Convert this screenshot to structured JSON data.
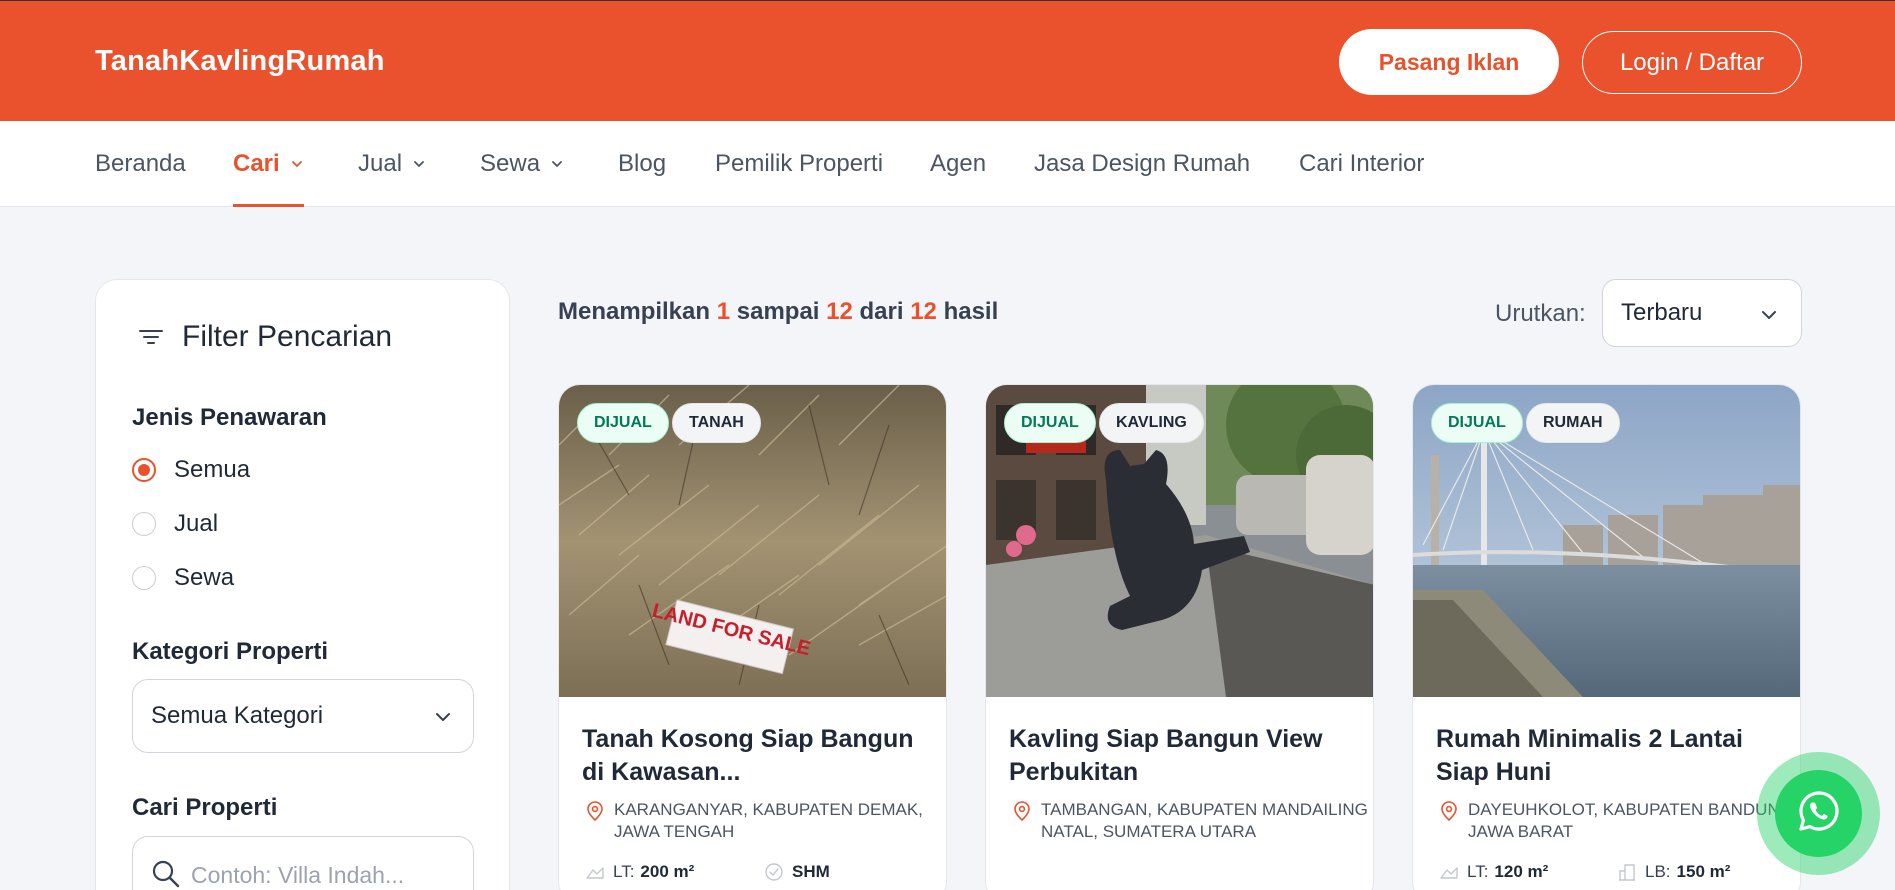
{
  "header": {
    "brand": "TanahKavlingRumah",
    "post_ad_label": "Pasang Iklan",
    "login_label": "Login / Daftar",
    "brand_color": "#e9522c"
  },
  "nav": {
    "items": [
      {
        "label": "Beranda"
      },
      {
        "label": "Cari",
        "active": true,
        "dropdown": true
      },
      {
        "label": "Jual",
        "dropdown": true
      },
      {
        "label": "Sewa",
        "dropdown": true
      },
      {
        "label": "Blog"
      },
      {
        "label": "Pemilik Properti"
      },
      {
        "label": "Agen"
      },
      {
        "label": "Jasa Design Rumah"
      },
      {
        "label": "Cari Interior"
      }
    ]
  },
  "filter": {
    "title": "Filter Pencarian",
    "offer_type_label": "Jenis Penawaran",
    "offer_options": [
      {
        "label": "Semua",
        "checked": true
      },
      {
        "label": "Jual",
        "checked": false
      },
      {
        "label": "Sewa",
        "checked": false
      }
    ],
    "category_label": "Kategori Properti",
    "category_value": "Semua Kategori",
    "search_label": "Cari Properti",
    "search_placeholder": "Contoh: Villa Indah..."
  },
  "results": {
    "prefix": "Menampilkan",
    "from": "1",
    "mid1": "sampai",
    "to": "12",
    "mid2": "dari",
    "total": "12",
    "suffix": "hasil",
    "sort_label": "Urutkan:",
    "sort_value": "Terbaru"
  },
  "listings": [
    {
      "offer_badge": "DIJUAL",
      "category_badge": "TANAH",
      "title": "Tanah Kosong Siap Bangun di Kawasan...",
      "location": "KARANGANYAR, KABUPATEN DEMAK, JAWA TENGAH",
      "spec1_label": "LT:",
      "spec1_value": "200 m²",
      "spec2_value": "SHM",
      "image_sign": "LAND FOR SALE"
    },
    {
      "offer_badge": "DIJUAL",
      "category_badge": "KAVLING",
      "title": "Kavling Siap Bangun View Perbukitan",
      "location": "TAMBANGAN, KABUPATEN MANDAILING NATAL, SUMATERA UTARA"
    },
    {
      "offer_badge": "DIJUAL",
      "category_badge": "RUMAH",
      "title": "Rumah Minimalis 2 Lantai Siap Huni",
      "location": "DAYEUHKOLOT, KABUPATEN BANDUNG, JAWA BARAT",
      "spec1_label": "LT:",
      "spec1_value": "120 m²",
      "spec2_label": "LB:",
      "spec2_value": "150 m²"
    }
  ],
  "icons": {
    "filter": "filter-lines-icon",
    "chevron": "chevron-down-icon",
    "search": "search-icon",
    "pin": "map-pin-icon",
    "whatsapp": "whatsapp-icon"
  }
}
